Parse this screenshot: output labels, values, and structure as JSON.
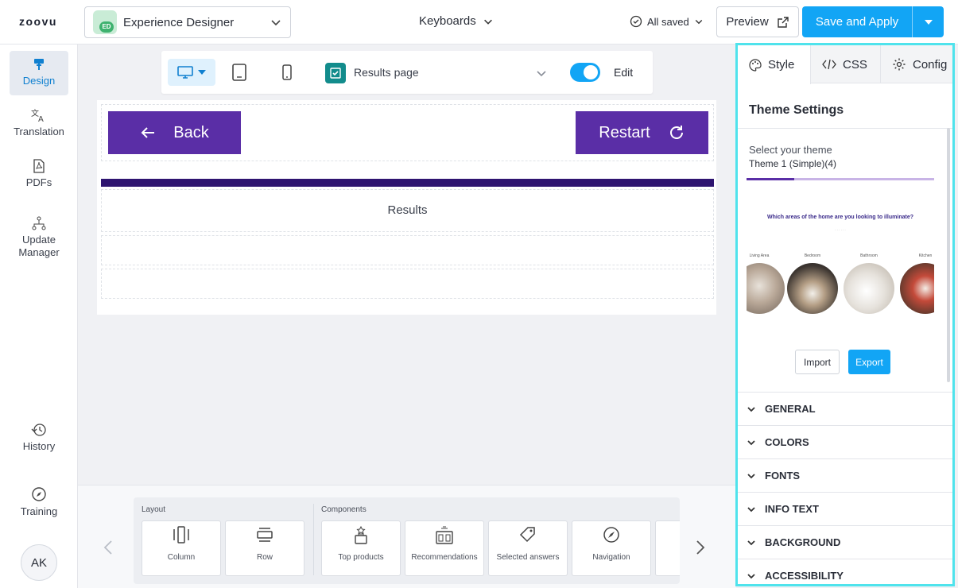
{
  "header": {
    "logo": "zoovu",
    "app_badge": "ED",
    "app_name": "Experience Designer",
    "project_name": "Keyboards",
    "save_status": "All saved",
    "preview_label": "Preview",
    "save_label": "Save and Apply"
  },
  "sidebar": {
    "items": [
      {
        "label": "Design",
        "icon": "paint-roller-icon"
      },
      {
        "label": "Translation",
        "icon": "translate-icon"
      },
      {
        "label": "PDFs",
        "icon": "pdf-icon"
      },
      {
        "label": "Update Manager",
        "icon": "hierarchy-icon"
      },
      {
        "label": "History",
        "icon": "history-icon"
      },
      {
        "label": "Training",
        "icon": "compass-icon"
      }
    ],
    "avatar": "AK"
  },
  "toolbar": {
    "page_selector": "Results page",
    "edit_label": "Edit",
    "edit_enabled": true
  },
  "canvas": {
    "back_label": "Back",
    "restart_label": "Restart",
    "results_text": "Results",
    "accent_color": "#5a2ea6"
  },
  "palette": {
    "layout_header": "Layout",
    "components_header": "Components",
    "layout_items": [
      "Column",
      "Row"
    ],
    "component_items": [
      "Top products",
      "Recommendations",
      "Selected answers",
      "Navigation"
    ]
  },
  "panel": {
    "tabs": [
      "Style",
      "CSS",
      "Config"
    ],
    "title": "Theme Settings",
    "select_label": "Select your theme",
    "theme_name": "Theme 1 (Simple)(4)",
    "preview": {
      "question": "Which areas of the home are you looking to illuminate?",
      "rooms": [
        "Living Area",
        "Bedroom",
        "Bathroom",
        "Kitchen"
      ]
    },
    "import_label": "Import",
    "export_label": "Export",
    "sections": [
      "GENERAL",
      "COLORS",
      "FONTS",
      "INFO TEXT",
      "BACKGROUND",
      "ACCESSIBILITY"
    ]
  }
}
